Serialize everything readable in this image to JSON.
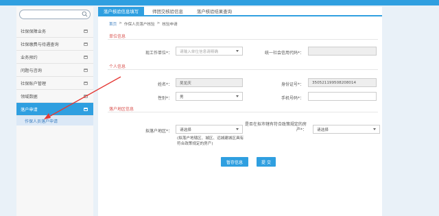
{
  "sidebar": {
    "search_placeholder": "",
    "items": [
      {
        "label": "社保保障业务"
      },
      {
        "label": "社保缴费与待遇查询"
      },
      {
        "label": "业务预约"
      },
      {
        "label": "问题与咨询"
      },
      {
        "label": "社保账户管理"
      },
      {
        "label": "领域数据"
      },
      {
        "label": "落户申请"
      }
    ],
    "sub_item": "作保人员落户申请"
  },
  "tabs": [
    {
      "label": "落户核验信息填写"
    },
    {
      "label": "师团交核验信息"
    },
    {
      "label": "落户核验结果查询"
    }
  ],
  "breadcrumb": {
    "home": "首页",
    "sep1": ">",
    "level1": "作保人员落户核验",
    "sep2": ">",
    "level2": "核验申请"
  },
  "sections": {
    "unit": "单位信息",
    "personal": "个人信息",
    "area": "落户地区信息"
  },
  "form": {
    "employer_label": "现工作单位*：",
    "employer_placeholder": "请输入单位信息请精确",
    "credit_code_label": "统一社会信用代码*：",
    "credit_code_value": "",
    "name_label": "姓名*：",
    "name_value": "吴龙庆",
    "id_label": "身份证号*：",
    "id_value": "350521199508208014",
    "gender_label": "性别*：",
    "gender_value": "男",
    "phone_label": "手机号码*：",
    "phone_value": "",
    "district_label": "拟落户地区*：",
    "district_value": "请选择",
    "policy_label": "是否在拟市辖有符合政策规定的房产*：",
    "policy_value": "请选择",
    "note": "(拟落户地辖区、城区、远城建城区具有符合政策规定的房产)"
  },
  "buttons": {
    "save": "暂存信息",
    "submit": "提 交"
  },
  "colors": {
    "accent": "#2f9fe0",
    "section_title": "#d9534f",
    "annotation_arrow": "#e53935"
  }
}
